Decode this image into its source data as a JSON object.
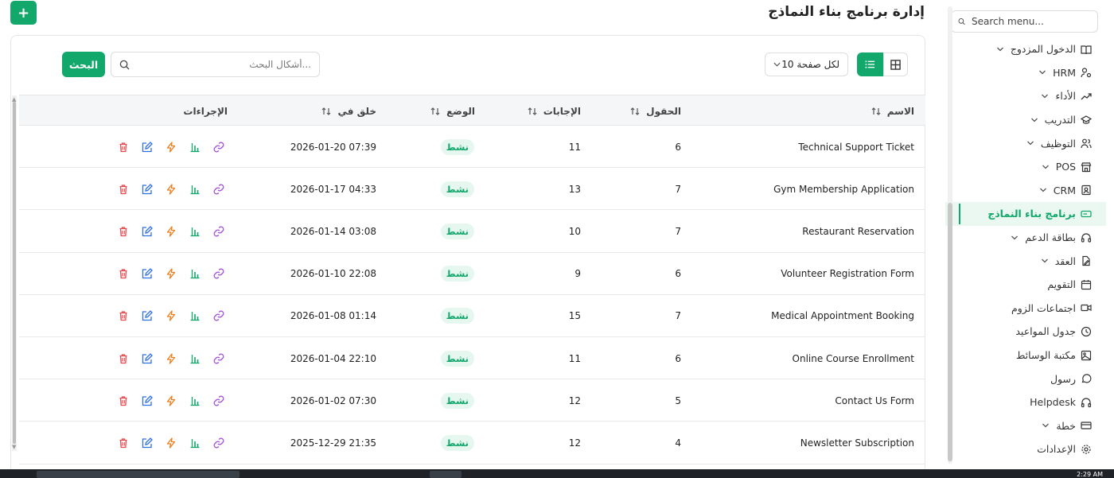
{
  "app": {
    "title": "إدارة برنامج بناء النماذج",
    "add_button_label": "+"
  },
  "sidebar": {
    "search_placeholder": "Search menu...",
    "items": [
      {
        "label": "الدخول المزدوج",
        "icon": "book-open-icon",
        "has_chevron": true
      },
      {
        "label": "HRM",
        "icon": "user-cog-icon",
        "has_chevron": true
      },
      {
        "label": "الأداء",
        "icon": "trending-up-icon",
        "has_chevron": true
      },
      {
        "label": "التدريب",
        "icon": "graduation-cap-icon",
        "has_chevron": true
      },
      {
        "label": "التوظيف",
        "icon": "users-icon",
        "has_chevron": true
      },
      {
        "label": "POS",
        "icon": "store-icon",
        "has_chevron": true
      },
      {
        "label": "CRM",
        "icon": "contact-icon",
        "has_chevron": true
      },
      {
        "label": "برنامج بناء النماذج",
        "icon": "form-input-icon",
        "has_chevron": false,
        "active": true
      },
      {
        "label": "بطاقة الدعم",
        "icon": "headset-icon",
        "has_chevron": true
      },
      {
        "label": "العقد",
        "icon": "file-signature-icon",
        "has_chevron": true
      },
      {
        "label": "التقويم",
        "icon": "calendar-icon",
        "has_chevron": false
      },
      {
        "label": "اجتماعات الزوم",
        "icon": "video-icon",
        "has_chevron": false
      },
      {
        "label": "جدول المواعيد",
        "icon": "clock-icon",
        "has_chevron": false
      },
      {
        "label": "مكتبة الوسائط",
        "icon": "image-icon",
        "has_chevron": false
      },
      {
        "label": "رسول",
        "icon": "message-circle-icon",
        "has_chevron": false
      },
      {
        "label": "Helpdesk",
        "icon": "headphones-icon",
        "has_chevron": false
      },
      {
        "label": "خطة",
        "icon": "credit-card-icon",
        "has_chevron": true
      },
      {
        "label": "الإعدادات",
        "icon": "gear-icon",
        "has_chevron": false
      }
    ]
  },
  "toolbar": {
    "per_page_label": "لكل صفحة 10",
    "search_placeholder": "أشكال البحث...",
    "search_button_label": "البحث"
  },
  "table": {
    "columns": {
      "name": "الاسم",
      "fields": "الحقول",
      "responses": "الإجابات",
      "status": "الوضع",
      "created_at": "خلق في",
      "actions": "الإجراءات"
    },
    "rows": [
      {
        "name": "Technical Support Ticket",
        "fields": "6",
        "responses": "11",
        "status": "نشط",
        "created_at": "2026-01-20 07:39"
      },
      {
        "name": "Gym Membership Application",
        "fields": "7",
        "responses": "13",
        "status": "نشط",
        "created_at": "2026-01-17 04:33"
      },
      {
        "name": "Restaurant Reservation",
        "fields": "7",
        "responses": "10",
        "status": "نشط",
        "created_at": "2026-01-14 03:08"
      },
      {
        "name": "Volunteer Registration Form",
        "fields": "6",
        "responses": "9",
        "status": "نشط",
        "created_at": "2026-01-10 22:08"
      },
      {
        "name": "Medical Appointment Booking",
        "fields": "7",
        "responses": "15",
        "status": "نشط",
        "created_at": "2026-01-08 01:14"
      },
      {
        "name": "Online Course Enrollment",
        "fields": "6",
        "responses": "11",
        "status": "نشط",
        "created_at": "2026-01-04 22:10"
      },
      {
        "name": "Contact Us Form",
        "fields": "5",
        "responses": "12",
        "status": "نشط",
        "created_at": "2026-01-02 07:30"
      },
      {
        "name": "Newsletter Subscription",
        "fields": "4",
        "responses": "12",
        "status": "نشط",
        "created_at": "2025-12-29 21:35"
      }
    ]
  },
  "taskbar": {
    "clock": "2:29 AM"
  },
  "colors": {
    "accent": "#13a86b",
    "delete": "#e5484d",
    "edit": "#2f6fe4",
    "automation": "#f07c1b",
    "analytics": "#13a86b",
    "link": "#a24ad8"
  }
}
